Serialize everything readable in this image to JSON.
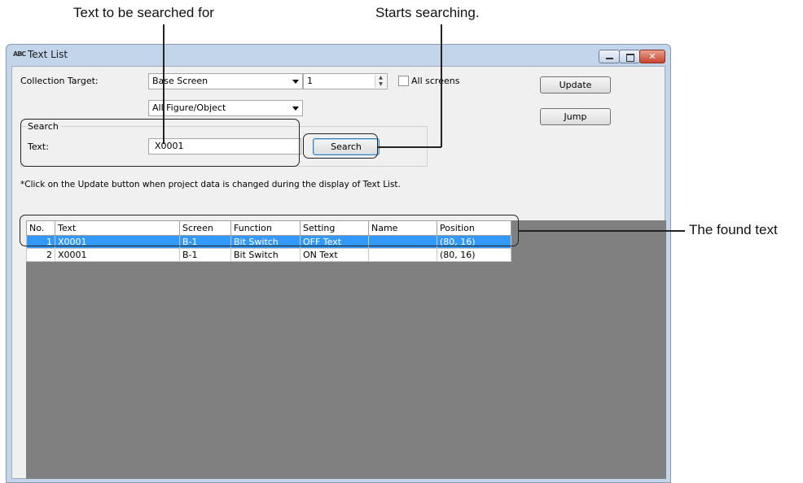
{
  "callouts": {
    "search_text": "Text to be searched for",
    "starts_search": "Starts searching.",
    "found_text": "The found text"
  },
  "window": {
    "title": "Text List",
    "icon": "text-list-icon",
    "icon_glyph": "ABC"
  },
  "form": {
    "collection_target_label": "Collection Target:",
    "screen_type": "Base Screen",
    "screen_number": "1",
    "all_screens_label": "All screens",
    "figure_filter": "All Figure/Object",
    "update_button": "Update",
    "jump_button": "Jump",
    "search_group_label": "Search",
    "text_label": "Text:",
    "search_value": "X0001",
    "search_button": "Search",
    "note": "*Click on the Update button when project data is changed during the display of Text List."
  },
  "table": {
    "columns": [
      "No.",
      "Text",
      "Screen",
      "Function",
      "Setting",
      "Name",
      "Position"
    ],
    "rows": [
      [
        "1",
        "X0001",
        "B-1",
        "Bit Switch",
        "OFF Text",
        "",
        "(80, 16)"
      ],
      [
        "2",
        "X0001",
        "B-1",
        "Bit Switch",
        "ON Text",
        "",
        "(80, 16)"
      ]
    ],
    "selected_row": 0
  },
  "colors": {
    "selection": "#3399ff",
    "grid_background": "#808080",
    "window_frame": "#c3d5ea"
  }
}
